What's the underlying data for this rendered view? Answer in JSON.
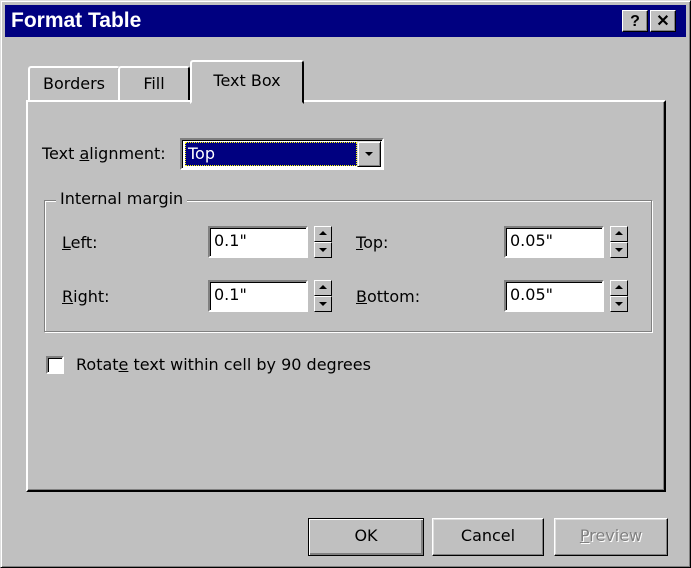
{
  "window": {
    "title": "Format Table",
    "help_label": "?",
    "close_label": "✕"
  },
  "tabs": [
    {
      "label": "Borders",
      "active": false
    },
    {
      "label": "Fill",
      "active": false
    },
    {
      "label": "Text Box",
      "active": true
    }
  ],
  "text_alignment": {
    "label_before": "Text ",
    "label_accel": "a",
    "label_after": "lignment:",
    "value": "Top"
  },
  "internal_margin": {
    "legend": "Internal margin",
    "left": {
      "accel": "L",
      "rest": "eft:",
      "value": "0.1\""
    },
    "right": {
      "accel": "R",
      "rest": "ight:",
      "value": "0.1\""
    },
    "top": {
      "accel": "T",
      "rest": "op:",
      "value": "0.05\""
    },
    "bottom": {
      "accel": "B",
      "rest": "ottom:",
      "value": "0.05\""
    }
  },
  "rotate": {
    "label_before": "Rotat",
    "label_accel": "e",
    "label_after": " text within cell by 90 degrees",
    "checked": false
  },
  "buttons": {
    "ok": "OK",
    "cancel": "Cancel",
    "preview_accel": "P",
    "preview_rest": "review",
    "preview_enabled": false
  },
  "colors": {
    "face": "#c0c0c0",
    "titlebar": "#000080",
    "selection": "#000080"
  }
}
